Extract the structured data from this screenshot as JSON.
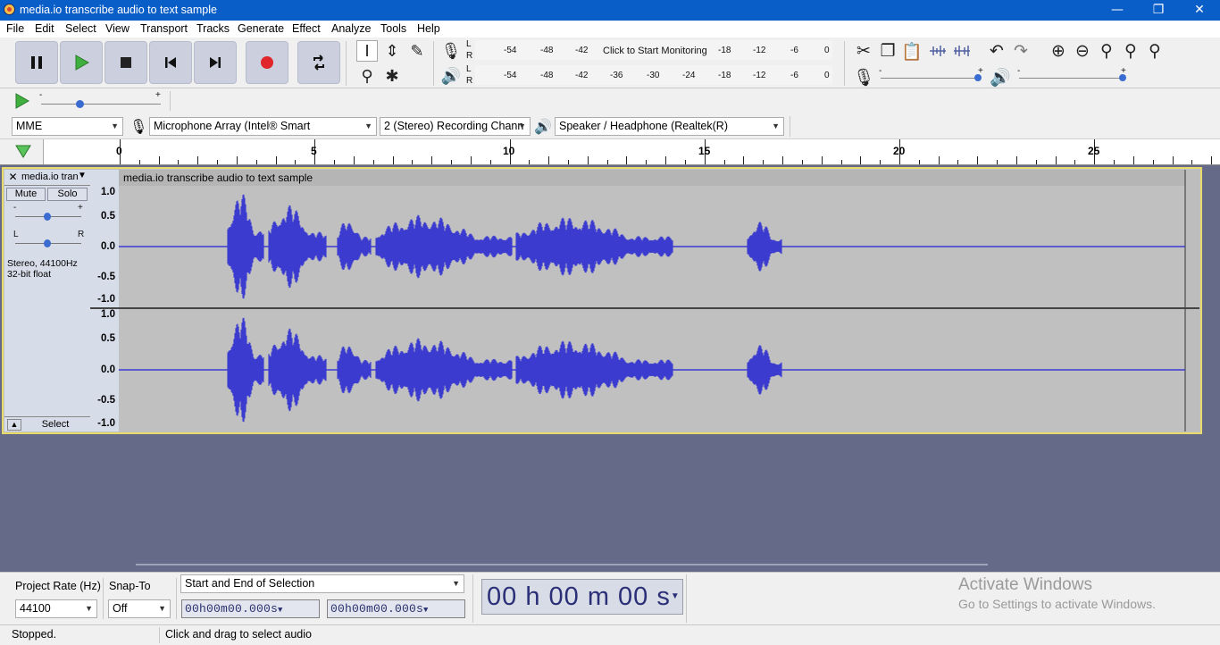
{
  "window": {
    "title": "media.io transcribe audio to text sample",
    "minimize": "—",
    "restore": "❐",
    "close": "✕"
  },
  "menu": [
    "File",
    "Edit",
    "Select",
    "View",
    "Transport",
    "Tracks",
    "Generate",
    "Effect",
    "Analyze",
    "Tools",
    "Help"
  ],
  "meters": {
    "record_ticks": [
      "-54",
      "-48",
      "-42",
      "-18",
      "-12",
      "-6",
      "0"
    ],
    "record_prompt": "Click to Start Monitoring",
    "play_ticks": [
      "-54",
      "-48",
      "-42",
      "-36",
      "-30",
      "-24",
      "-18",
      "-12",
      "-6",
      "0"
    ],
    "L": "L",
    "R": "R"
  },
  "mixer": {
    "minus": "-",
    "plus": "+"
  },
  "devices": {
    "host": "MME",
    "recording_device": "Microphone Array (Intel® Smart",
    "channels": "2 (Stereo) Recording Chann",
    "playback_device": "Speaker / Headphone (Realtek(R)"
  },
  "ruler": {
    "labels": [
      "0",
      "5",
      "10",
      "15",
      "20",
      "25"
    ]
  },
  "track": {
    "name": "media.io tran",
    "clip_name": "media.io transcribe audio to text sample",
    "mute": "Mute",
    "solo": "Solo",
    "gain_minus": "-",
    "gain_plus": "+",
    "pan_left": "L",
    "pan_right": "R",
    "info_line1": "Stereo, 44100Hz",
    "info_line2": "32-bit float",
    "select": "Select",
    "scale_top": [
      "1.0",
      "0.5",
      "0.0",
      "-0.5",
      "-1.0"
    ],
    "scale_bottom": [
      "1.0",
      "0.5",
      "0.0",
      "-0.5",
      "-1.0"
    ]
  },
  "selection": {
    "project_rate_label": "Project Rate (Hz)",
    "project_rate": "44100",
    "snap_label": "Snap-To",
    "snap": "Off",
    "mode": "Start and End of Selection",
    "start": "00h00m00.000s",
    "end": "00h00m00.000s",
    "audio_position": "00 h 00 m 00 s"
  },
  "watermark": {
    "line1": "Activate Windows",
    "line2": "Go to Settings to activate Windows."
  },
  "status": {
    "state": "Stopped.",
    "hint": "Click and drag to select audio"
  },
  "colors": {
    "waveform": "#3b3bd0",
    "selection_border": "#e8da6a",
    "title_bar": "#0a5ec8"
  }
}
